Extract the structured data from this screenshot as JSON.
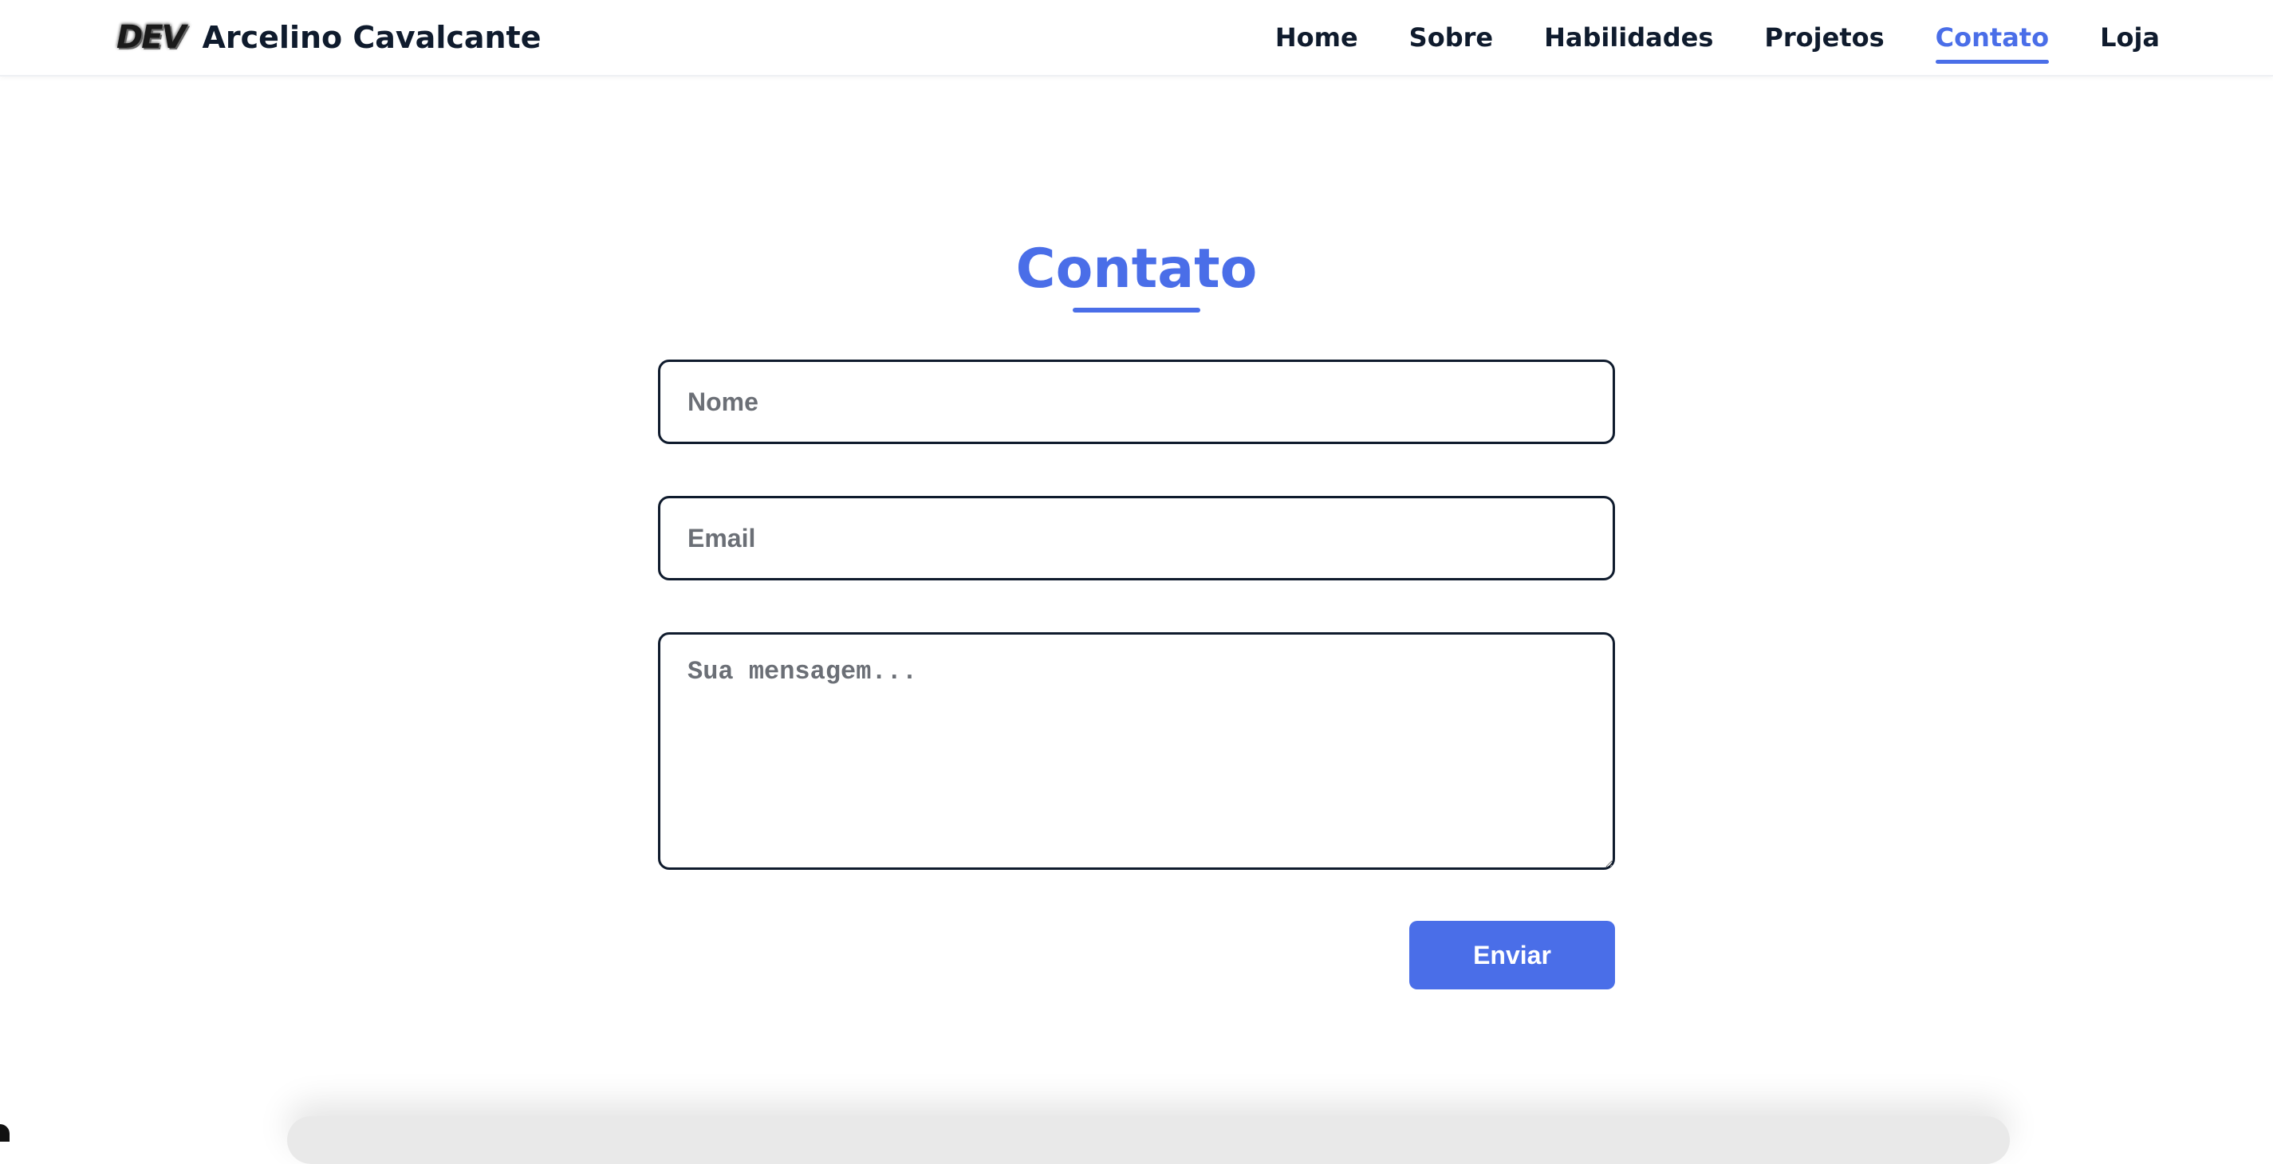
{
  "header": {
    "logo_text": "DEV",
    "brand_name": "Arcelino Cavalcante",
    "nav": [
      {
        "label": "Home",
        "active": false
      },
      {
        "label": "Sobre",
        "active": false
      },
      {
        "label": "Habilidades",
        "active": false
      },
      {
        "label": "Projetos",
        "active": false
      },
      {
        "label": "Contato",
        "active": true
      },
      {
        "label": "Loja",
        "active": false
      }
    ]
  },
  "contact": {
    "title": "Contato",
    "name_placeholder": "Nome",
    "name_value": "",
    "email_placeholder": "Email",
    "email_value": "",
    "message_placeholder": "Sua mensagem...",
    "message_value": "",
    "submit_label": "Enviar"
  },
  "colors": {
    "accent": "#4a6ee8",
    "text": "#0f1b2d",
    "background": "#ffffff"
  }
}
